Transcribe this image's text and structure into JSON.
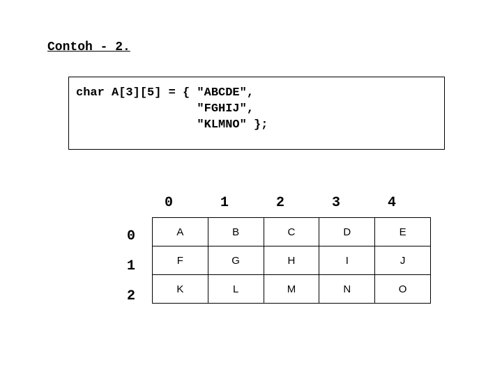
{
  "title": "Contoh - 2.",
  "code": {
    "line1": "char A[3][5] = { \"ABCDE\",",
    "line2": "                 \"FGHIJ\",",
    "line3": "                 \"KLMNO\" };"
  },
  "col_headers": [
    "0",
    "1",
    "2",
    "3",
    "4"
  ],
  "row_headers": [
    "0",
    "1",
    "2"
  ],
  "grid": [
    [
      "A",
      "B",
      "C",
      "D",
      "E"
    ],
    [
      "F",
      "G",
      "H",
      "I",
      "J"
    ],
    [
      "K",
      "L",
      "M",
      "N",
      "O"
    ]
  ]
}
